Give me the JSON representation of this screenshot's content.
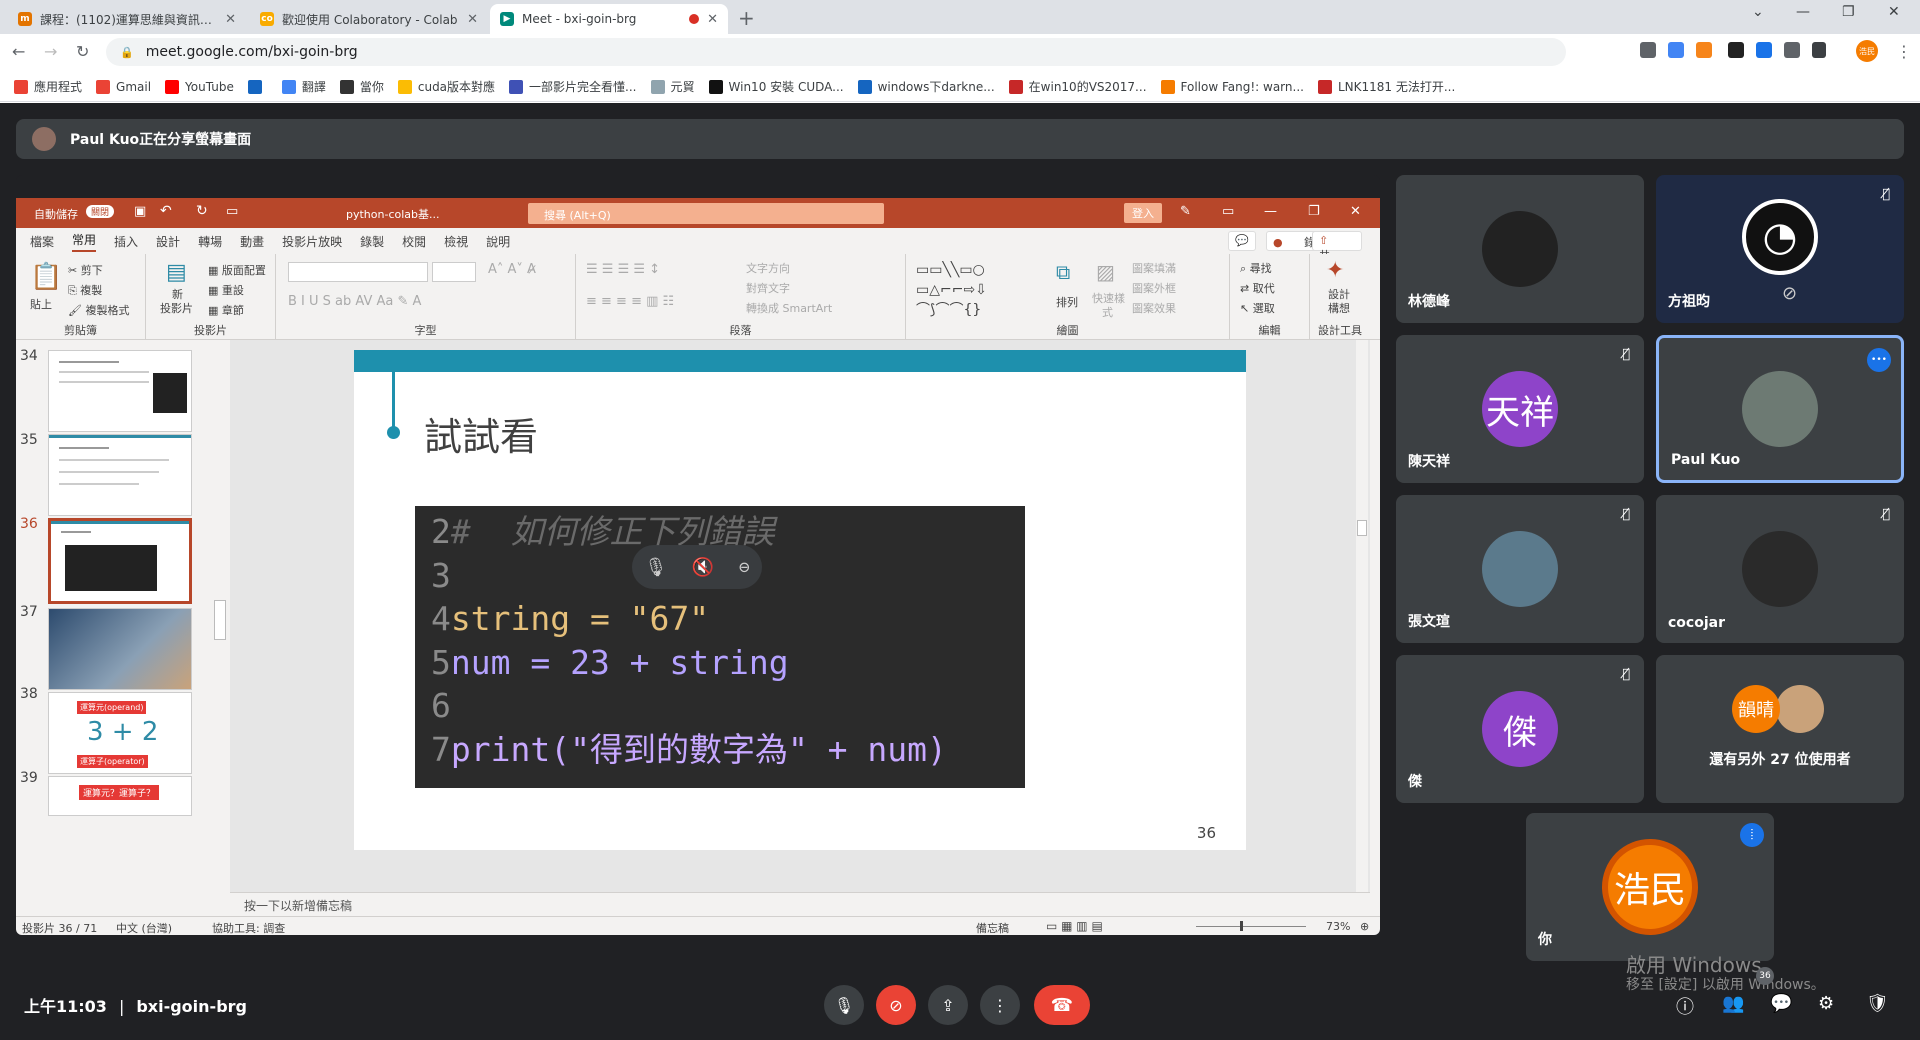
{
  "browser": {
    "tabs": [
      {
        "title": "課程：(1102)運算思維與資訊科技",
        "fav_color": "#e37400"
      },
      {
        "title": "歡迎使用 Colaboratory - Colab",
        "fav_color": "#f9ab00"
      },
      {
        "title": "Meet - bxi-goin-brg",
        "fav_color": "#00897b"
      }
    ],
    "url": "meet.google.com/bxi-goin-brg",
    "profile_initials": "浩民",
    "bookmarks": [
      {
        "label": "應用程式",
        "color": "#ea4335"
      },
      {
        "label": "Gmail",
        "color": "#ea4335"
      },
      {
        "label": "YouTube",
        "color": "#ff0000"
      },
      {
        "label": "",
        "color": "#1565c0"
      },
      {
        "label": "翻譯",
        "color": "#4285f4"
      },
      {
        "label": "當你",
        "color": "#333333"
      },
      {
        "label": "cuda版本對應",
        "color": "#fbbc04"
      },
      {
        "label": "一部影片完全看懂...",
        "color": "#3f51b5"
      },
      {
        "label": "元貿",
        "color": "#90a4ae"
      },
      {
        "label": "Win10 安裝 CUDA...",
        "color": "#111111"
      },
      {
        "label": "windows下darkne...",
        "color": "#1565c0"
      },
      {
        "label": "在win10的VS2017...",
        "color": "#c62828"
      },
      {
        "label": "Follow Fang!: warn...",
        "color": "#f57c00"
      },
      {
        "label": "LNK1181 无法打开...",
        "color": "#c62828"
      }
    ]
  },
  "meet": {
    "share_banner": "Paul Kuo正在分享螢幕畫面",
    "time": "上午11:03",
    "meeting_code": "bxi-goin-brg",
    "participants": [
      {
        "name": "林德峰",
        "initial": "",
        "avatar_color": "#222222",
        "muted": false
      },
      {
        "name": "方祖昀",
        "initial": "",
        "avatar_color": "#1f2a44",
        "muted": true
      },
      {
        "name": "陳天祥",
        "initial": "天祥",
        "avatar_color": "#8e44c9",
        "muted": true
      },
      {
        "name": "Paul Kuo",
        "initial": "",
        "avatar_color": "#6d7a73",
        "muted": false
      },
      {
        "name": "張文瑄",
        "initial": "",
        "avatar_color": "#5b7a8c",
        "muted": true
      },
      {
        "name": "cocojar",
        "initial": "",
        "avatar_color": "#2a2a2a",
        "muted": true
      },
      {
        "name": "傑",
        "initial": "傑",
        "avatar_color": "#8e44c9",
        "muted": true
      },
      {
        "name": "還有另外 27 位使用者",
        "initial": "韻晴",
        "avatar_color": "#f57c00",
        "muted": false
      }
    ],
    "self": {
      "name": "你",
      "initial": "浩民",
      "avatar_color": "#f57c00"
    },
    "windows_watermark": {
      "line1": "啟用 Windows",
      "line2": "移至 [設定] 以啟用 Windows。"
    },
    "chat_badge": "36"
  },
  "ppt": {
    "autosave": "自動儲存",
    "autosave_state": "關閉",
    "file_name": "python-colab基...",
    "search_placeholder": "搜尋 (Alt+Q)",
    "login": "登入",
    "menu": [
      "檔案",
      "常用",
      "插入",
      "設計",
      "轉場",
      "動畫",
      "投影片放映",
      "錄製",
      "校閱",
      "檢視",
      "說明"
    ],
    "record_btn": "錄製",
    "share_btn": "共用",
    "ribbon": {
      "clipboard": {
        "label": "剪貼簿",
        "paste": "貼上",
        "cut": "剪下",
        "copy": "複製",
        "format": "複製格式"
      },
      "slides": {
        "label": "投影片",
        "new": "新",
        "new2": "投影片",
        "layout": "版面配置",
        "reset": "重設",
        "section": "章節"
      },
      "font": {
        "label": "字型"
      },
      "paragraph": {
        "label": "段落",
        "text_dir": "文字方向",
        "align_text": "對齊文字",
        "smartart": "轉換成 SmartArt"
      },
      "drawing": {
        "label": "繪圖",
        "arrange": "排列",
        "quick": "快速樣",
        "quick2": "式",
        "fill": "圖案填滿",
        "outline": "圖案外框",
        "effect": "圖案效果"
      },
      "editing": {
        "label": "編輯",
        "find": "尋找",
        "replace": "取代",
        "select": "選取"
      },
      "designer": {
        "label": "設計工具",
        "btn": "設計",
        "btn2": "構想"
      }
    },
    "slide_numbers": [
      "34",
      "35",
      "36",
      "37",
      "38",
      "39"
    ],
    "thumb38": {
      "top": "運算元(operand)",
      "formula": "3 + 2",
      "bottom": "運算子(operator)"
    },
    "thumb39": "運算元？運算子？",
    "slide": {
      "title": "試試看",
      "page": "36",
      "code": [
        {
          "n": "2",
          "text": "#  如何修正下列錯誤"
        },
        {
          "n": "3",
          "text": ""
        },
        {
          "n": "4",
          "text": "string = \"67\""
        },
        {
          "n": "5",
          "text": "num = 23 + string"
        },
        {
          "n": "6",
          "text": ""
        },
        {
          "n": "7",
          "text": "print(\"得到的數字為\" + num)"
        }
      ]
    },
    "notes_placeholder": "按一下以新增備忘稿",
    "status": {
      "slide_of": "投影片 36 / 71",
      "lang": "中文 (台灣)",
      "access": "協助工具: 調查",
      "notes": "備忘稿",
      "zoom": "73%"
    }
  }
}
